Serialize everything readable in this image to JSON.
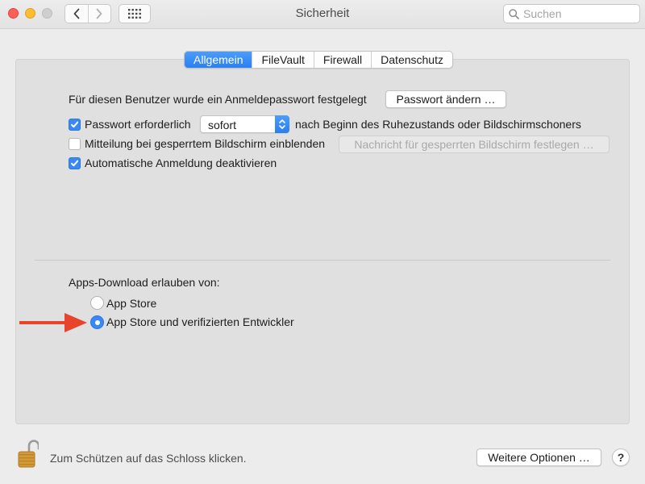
{
  "window": {
    "title": "Sicherheit",
    "search_placeholder": "Suchen"
  },
  "tabs": [
    {
      "label": "Allgemein",
      "active": true
    },
    {
      "label": "FileVault",
      "active": false
    },
    {
      "label": "Firewall",
      "active": false
    },
    {
      "label": "Datenschutz",
      "active": false
    }
  ],
  "general": {
    "login_password_text": "Für diesen Benutzer wurde ein Anmeldepasswort festgelegt",
    "change_password_button": "Passwort ändern …",
    "require_password": {
      "checked": true,
      "label": "Passwort erforderlich",
      "select_value": "sofort",
      "suffix": "nach Beginn des Ruhezustands oder Bildschirmschoners"
    },
    "show_message": {
      "checked": false,
      "label": "Mitteilung bei gesperrtem Bildschirm einblenden",
      "button": "Nachricht für gesperrten Bildschirm festlegen …"
    },
    "disable_autologin": {
      "checked": true,
      "label": "Automatische Anmeldung deaktivieren"
    }
  },
  "downloads": {
    "heading": "Apps-Download erlauben von:",
    "options": [
      {
        "label": "App Store",
        "selected": false
      },
      {
        "label": "App Store und verifizierten Entwickler",
        "selected": true
      }
    ]
  },
  "footer": {
    "lock_text": "Zum Schützen auf das Schloss klicken.",
    "more_options_button": "Weitere Optionen …",
    "help_label": "?"
  },
  "colors": {
    "accent": "#3a87f5",
    "arrow": "#e8432b",
    "lock": "#d49a3a"
  }
}
